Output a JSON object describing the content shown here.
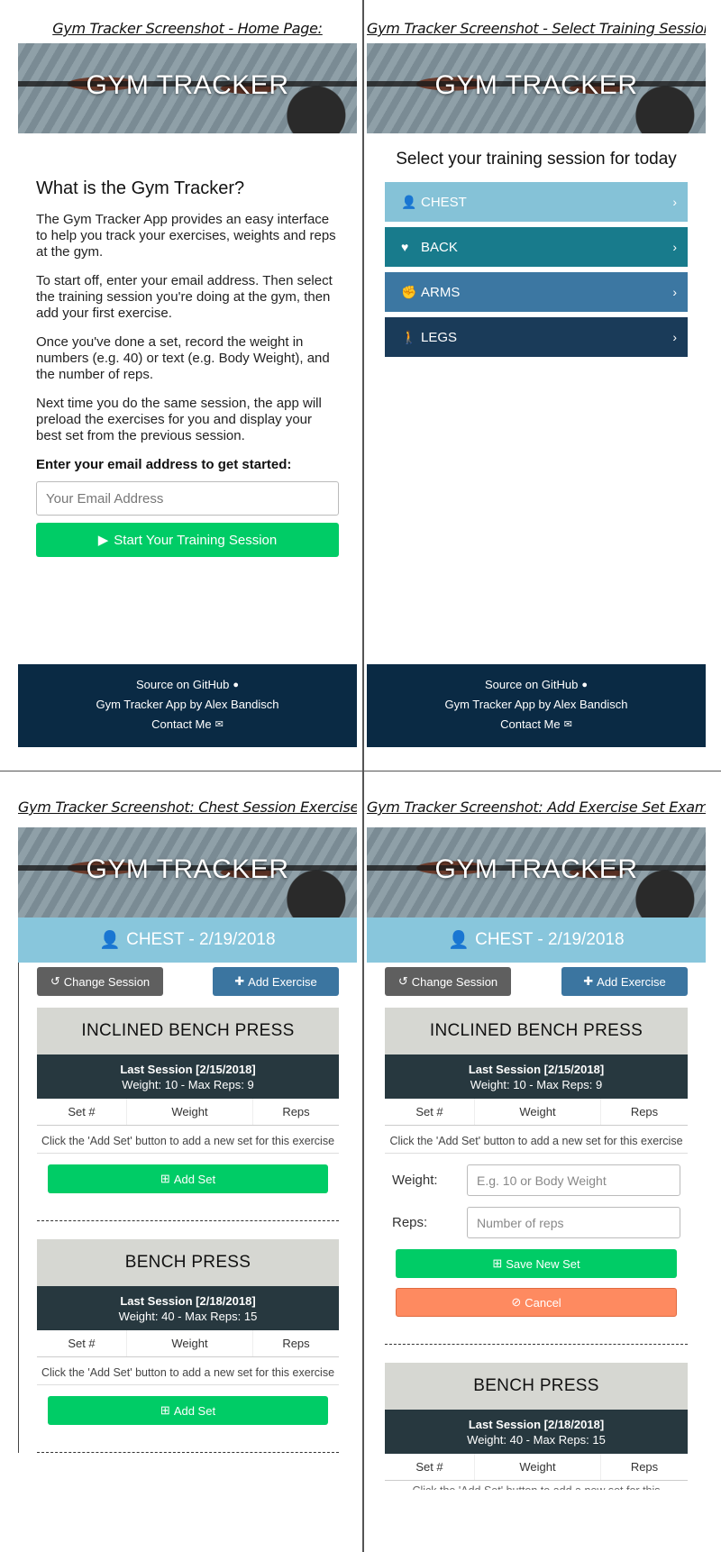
{
  "captions": {
    "home": "Gym Tracker Screenshot - Home Page:",
    "select": "Gym Tracker Screenshot - Select Training Session",
    "chest": "Gym Tracker Screenshot: Chest Session Exercises",
    "add_set": "Gym Tracker Screenshot: Add Exercise Set Example"
  },
  "banner": {
    "title": "GYM TRACKER"
  },
  "home": {
    "heading": "What is the Gym Tracker?",
    "paragraphs": [
      "The Gym Tracker App provides an easy interface to help you track your exercises, weights and reps at the gym.",
      "To start off, enter your email address. Then select the training session you're doing at the gym, then add your first exercise.",
      "Once you've done a set, record the weight in numbers (e.g. 40) or text (e.g. Body Weight), and the number of reps.",
      "Next time you do the same session, the app will preload the exercises for you and display your best set from the previous session."
    ],
    "email_label": "Enter your email address to get started:",
    "email_placeholder": "Your Email Address",
    "start_button": "Start Your Training Session"
  },
  "footer": {
    "source": "Source on GitHub",
    "credit": "Gym Tracker App by Alex Bandisch",
    "contact": "Contact Me"
  },
  "select": {
    "title": "Select your training session for today",
    "sessions": [
      {
        "label": "CHEST",
        "icon": "user-icon",
        "color": "#85c2d7"
      },
      {
        "label": "BACK",
        "icon": "heart-icon",
        "color": "#187b8c"
      },
      {
        "label": "ARMS",
        "icon": "fist-icon",
        "color": "#3c77a2"
      },
      {
        "label": "LEGS",
        "icon": "person-icon",
        "color": "#1a3b59"
      }
    ]
  },
  "session_view": {
    "header": "CHEST - 2/19/2018",
    "change_session": "Change Session",
    "add_exercise": "Add Exercise",
    "columns": {
      "set": "Set #",
      "weight": "Weight",
      "reps": "Reps"
    },
    "empty_message": "Click the 'Add Set' button to add a new set for this exercise",
    "add_set": "Add Set",
    "exercises": [
      {
        "name": "INCLINED BENCH PRESS",
        "last_session": "Last Session [2/15/2018]",
        "summary": "Weight: 10 - Max Reps: 9"
      },
      {
        "name": "BENCH PRESS",
        "last_session": "Last Session [2/18/2018]",
        "summary": "Weight: 40 - Max Reps: 15"
      }
    ]
  },
  "add_set_form": {
    "weight_label": "Weight:",
    "weight_placeholder": "E.g. 10 or Body Weight",
    "reps_label": "Reps:",
    "reps_placeholder": "Number of reps",
    "save": "Save New Set",
    "cancel": "Cancel",
    "cut_text": "Click the 'Add Set' button to add a new set for this"
  },
  "colors": {
    "green": "#00cc66",
    "footer": "#0a2a44",
    "session_header": "#88c6dc",
    "last_session_bg": "#27383f",
    "cancel": "#fe8a60"
  }
}
